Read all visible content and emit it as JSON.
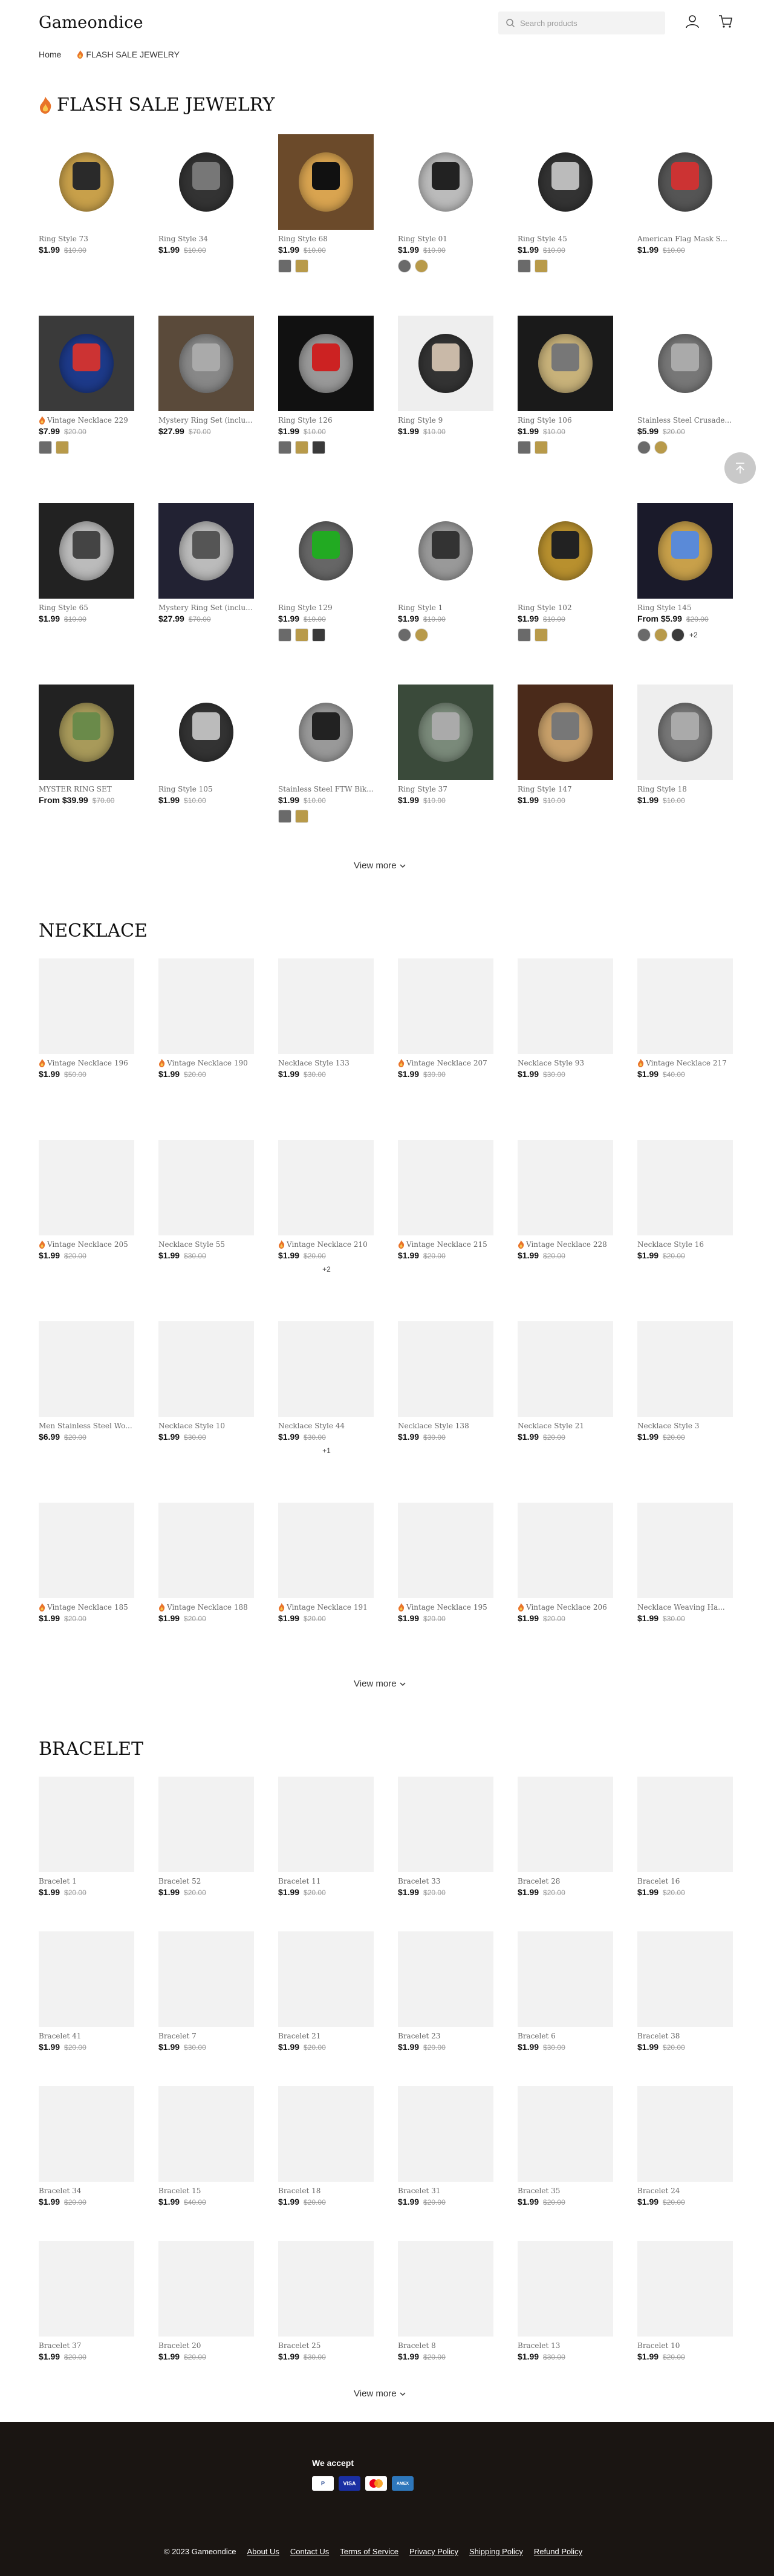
{
  "header": {
    "logo": "Gameondice",
    "search_placeholder": "Search products",
    "icons": [
      "search-icon",
      "account-icon",
      "cart-icon"
    ]
  },
  "breadcrumb": {
    "home": "Home",
    "current": "FLASH SALE JEWELRY"
  },
  "sections": {
    "flash": {
      "title": "FLASH SALE JEWELRY",
      "view_more": "View more",
      "products": [
        {
          "title": "Ring Style 73",
          "price": "$1.99",
          "compare": "$10.00",
          "swatches": 0,
          "flame": false
        },
        {
          "title": "Ring Style 34",
          "price": "$1.99",
          "compare": "$10.00",
          "swatches": 0,
          "flame": false
        },
        {
          "title": "Ring Style 68",
          "price": "$1.99",
          "compare": "$10.00",
          "swatches": 2,
          "flame": false
        },
        {
          "title": "Ring Style 01",
          "price": "$1.99",
          "compare": "$10.00",
          "swatches": 2,
          "flame": false
        },
        {
          "title": "Ring Style 45",
          "price": "$1.99",
          "compare": "$10.00",
          "swatches": 2,
          "flame": false
        },
        {
          "title": "American Flag Mask S...",
          "price": "$1.99",
          "compare": "$10.00",
          "swatches": 0,
          "flame": false
        },
        {
          "title": "Vintage Necklace 229",
          "price": "$7.99",
          "compare": "$20.00",
          "swatches": 2,
          "flame": true
        },
        {
          "title": "Mystery Ring Set (inclu...",
          "price": "$27.99",
          "compare": "$70.00",
          "swatches": 0,
          "flame": false
        },
        {
          "title": "Ring Style 126",
          "price": "$1.99",
          "compare": "$10.00",
          "swatches": 3,
          "flame": false
        },
        {
          "title": "Ring Style 9",
          "price": "$1.99",
          "compare": "$10.00",
          "swatches": 0,
          "flame": false
        },
        {
          "title": "Ring Style 106",
          "price": "$1.99",
          "compare": "$10.00",
          "swatches": 2,
          "flame": false
        },
        {
          "title": "Stainless Steel Crusade...",
          "price": "$5.99",
          "compare": "$20.00",
          "swatches": 2,
          "flame": false
        },
        {
          "title": "Ring Style 65",
          "price": "$1.99",
          "compare": "$10.00",
          "swatches": 0,
          "flame": false
        },
        {
          "title": "Mystery Ring Set (inclu...",
          "price": "$27.99",
          "compare": "$70.00",
          "swatches": 0,
          "flame": false
        },
        {
          "title": "Ring Style 129",
          "price": "$1.99",
          "compare": "$10.00",
          "swatches": 3,
          "flame": false
        },
        {
          "title": "Ring Style 1",
          "price": "$1.99",
          "compare": "$10.00",
          "swatches": 2,
          "flame": false
        },
        {
          "title": "Ring Style 102",
          "price": "$1.99",
          "compare": "$10.00",
          "swatches": 2,
          "flame": false
        },
        {
          "title": "Ring Style 145",
          "price": "From $5.99",
          "compare": "$20.00",
          "swatches": 3,
          "more": "+2",
          "flame": false
        },
        {
          "title": "MYSTER RING SET",
          "price": "From $39.99",
          "compare": "$70.00",
          "swatches": 0,
          "flame": false
        },
        {
          "title": "Ring Style 105",
          "price": "$1.99",
          "compare": "$10.00",
          "swatches": 0,
          "flame": false
        },
        {
          "title": "Stainless Steel FTW Bik...",
          "price": "$1.99",
          "compare": "$10.00",
          "swatches": 2,
          "flame": false
        },
        {
          "title": "Ring Style 37",
          "price": "$1.99",
          "compare": "$10.00",
          "swatches": 0,
          "flame": false
        },
        {
          "title": "Ring Style 147",
          "price": "$1.99",
          "compare": "$10.00",
          "swatches": 0,
          "flame": false
        },
        {
          "title": "Ring Style 18",
          "price": "$1.99",
          "compare": "$10.00",
          "swatches": 0,
          "flame": false
        }
      ]
    },
    "necklace": {
      "title": "NECKLACE",
      "view_more": "View more",
      "products": [
        {
          "title": "Vintage Necklace 196",
          "price": "$1.99",
          "compare": "$50.00",
          "flame": true
        },
        {
          "title": "Vintage Necklace 190",
          "price": "$1.99",
          "compare": "$20.00",
          "flame": true
        },
        {
          "title": "Necklace Style 133",
          "price": "$1.99",
          "compare": "$30.00",
          "flame": false
        },
        {
          "title": "Vintage Necklace 207",
          "price": "$1.99",
          "compare": "$30.00",
          "flame": true
        },
        {
          "title": "Necklace Style 93",
          "price": "$1.99",
          "compare": "$30.00",
          "flame": false
        },
        {
          "title": "Vintage Necklace 217",
          "price": "$1.99",
          "compare": "$40.00",
          "flame": true
        },
        {
          "title": "Vintage Necklace 205",
          "price": "$1.99",
          "compare": "$20.00",
          "flame": true
        },
        {
          "title": "Necklace Style 55",
          "price": "$1.99",
          "compare": "$30.00",
          "flame": false
        },
        {
          "title": "Vintage Necklace 210",
          "price": "$1.99",
          "compare": "$20.00",
          "flame": true,
          "more": "+2"
        },
        {
          "title": "Vintage Necklace 215",
          "price": "$1.99",
          "compare": "$20.00",
          "flame": true
        },
        {
          "title": "Vintage Necklace 228",
          "price": "$1.99",
          "compare": "$20.00",
          "flame": true
        },
        {
          "title": "Necklace Style 16",
          "price": "$1.99",
          "compare": "$20.00",
          "flame": false
        },
        {
          "title": "Men Stainless Steel Wo...",
          "price": "$6.99",
          "compare": "$20.00",
          "flame": false
        },
        {
          "title": "Necklace Style 10",
          "price": "$1.99",
          "compare": "$30.00",
          "flame": false
        },
        {
          "title": "Necklace Style 44",
          "price": "$1.99",
          "compare": "$30.00",
          "flame": false,
          "more": "+1"
        },
        {
          "title": "Necklace Style 138",
          "price": "$1.99",
          "compare": "$30.00",
          "flame": false
        },
        {
          "title": "Necklace Style 21",
          "price": "$1.99",
          "compare": "$20.00",
          "flame": false
        },
        {
          "title": "Necklace Style 3",
          "price": "$1.99",
          "compare": "$20.00",
          "flame": false
        },
        {
          "title": "Vintage Necklace 185",
          "price": "$1.99",
          "compare": "$20.00",
          "flame": true
        },
        {
          "title": "Vintage Necklace 188",
          "price": "$1.99",
          "compare": "$20.00",
          "flame": true
        },
        {
          "title": "Vintage Necklace 191",
          "price": "$1.99",
          "compare": "$20.00",
          "flame": true
        },
        {
          "title": "Vintage Necklace 195",
          "price": "$1.99",
          "compare": "$20.00",
          "flame": true
        },
        {
          "title": "Vintage Necklace 206",
          "price": "$1.99",
          "compare": "$20.00",
          "flame": true
        },
        {
          "title": "Necklace Weaving Ha...",
          "price": "$1.99",
          "compare": "$30.00",
          "flame": false
        }
      ]
    },
    "bracelet": {
      "title": "BRACELET",
      "view_more": "View more",
      "products": [
        {
          "title": "Bracelet 1",
          "price": "$1.99",
          "compare": "$20.00"
        },
        {
          "title": "Bracelet 52",
          "price": "$1.99",
          "compare": "$20.00"
        },
        {
          "title": "Bracelet 11",
          "price": "$1.99",
          "compare": "$20.00"
        },
        {
          "title": "Bracelet 33",
          "price": "$1.99",
          "compare": "$20.00"
        },
        {
          "title": "Bracelet 28",
          "price": "$1.99",
          "compare": "$20.00"
        },
        {
          "title": "Bracelet 16",
          "price": "$1.99",
          "compare": "$20.00"
        },
        {
          "title": "Bracelet 41",
          "price": "$1.99",
          "compare": "$20.00"
        },
        {
          "title": "Bracelet 7",
          "price": "$1.99",
          "compare": "$30.00"
        },
        {
          "title": "Bracelet 21",
          "price": "$1.99",
          "compare": "$20.00"
        },
        {
          "title": "Bracelet 23",
          "price": "$1.99",
          "compare": "$20.00"
        },
        {
          "title": "Bracelet 6",
          "price": "$1.99",
          "compare": "$30.00"
        },
        {
          "title": "Bracelet 38",
          "price": "$1.99",
          "compare": "$20.00"
        },
        {
          "title": "Bracelet 34",
          "price": "$1.99",
          "compare": "$20.00"
        },
        {
          "title": "Bracelet 15",
          "price": "$1.99",
          "compare": "$40.00"
        },
        {
          "title": "Bracelet 18",
          "price": "$1.99",
          "compare": "$20.00"
        },
        {
          "title": "Bracelet 31",
          "price": "$1.99",
          "compare": "$20.00"
        },
        {
          "title": "Bracelet 35",
          "price": "$1.99",
          "compare": "$20.00"
        },
        {
          "title": "Bracelet 24",
          "price": "$1.99",
          "compare": "$20.00"
        },
        {
          "title": "Bracelet 37",
          "price": "$1.99",
          "compare": "$20.00"
        },
        {
          "title": "Bracelet 20",
          "price": "$1.99",
          "compare": "$20.00"
        },
        {
          "title": "Bracelet 25",
          "price": "$1.99",
          "compare": "$30.00"
        },
        {
          "title": "Bracelet 8",
          "price": "$1.99",
          "compare": "$20.00"
        },
        {
          "title": "Bracelet 13",
          "price": "$1.99",
          "compare": "$30.00"
        },
        {
          "title": "Bracelet 10",
          "price": "$1.99",
          "compare": "$20.00"
        }
      ]
    }
  },
  "footer": {
    "we_accept": "We accept",
    "payments": [
      "P",
      "VISA",
      "",
      "AMEX"
    ],
    "copyright": "© 2023 Gameondice",
    "links": [
      "About Us",
      "Contact Us",
      "Terms of Service",
      "Privacy Policy",
      "Shipping Policy",
      "Refund Policy"
    ]
  },
  "colors": {
    "footer_bg": "#1a1512",
    "flame": "#e8732a"
  }
}
